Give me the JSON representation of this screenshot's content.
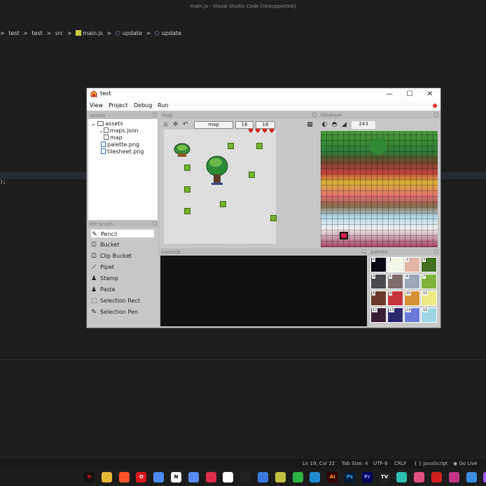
{
  "vscode": {
    "title": "main.js - Visual Studio Code [Unsupported]",
    "breadcrumb": [
      ">",
      "test",
      ">",
      "test",
      ">",
      "src",
      ">",
      "main.js",
      ">",
      "update",
      ">",
      "update"
    ],
    "code_fragment": ");",
    "status": {
      "position": "Ln 19, Col 22",
      "tab_size": "Tab Size: 4",
      "encoding": "UTF-8",
      "eol": "CRLF",
      "language": "{ } JavaScript",
      "golive": "Go Live"
    }
  },
  "taskbar": {
    "apps": [
      {
        "icon": "netflix-icon",
        "label": "N",
        "color": "#111111",
        "fg": "#e50914"
      },
      {
        "icon": "files-icon",
        "label": "",
        "color": "#e8b83a",
        "fg": "#fff"
      },
      {
        "icon": "brave-icon",
        "label": "",
        "color": "#fb542b",
        "fg": "#fff"
      },
      {
        "icon": "opera-icon",
        "label": "O",
        "color": "#e0131d",
        "fg": "#fff"
      },
      {
        "icon": "chrome-icon",
        "label": "",
        "color": "#4c8bf5",
        "fg": "#fff"
      },
      {
        "icon": "notion-icon",
        "label": "N",
        "color": "#ffffff",
        "fg": "#000"
      },
      {
        "icon": "photos-icon",
        "label": "",
        "color": "#5a8af0",
        "fg": "#fff"
      },
      {
        "icon": "disc-icon",
        "label": "",
        "color": "#e02f4d",
        "fg": "#fff"
      },
      {
        "icon": "github-icon",
        "label": "",
        "color": "#ffffff",
        "fg": "#000"
      },
      {
        "icon": "unity-icon",
        "label": "",
        "color": "#222222",
        "fg": "#fff"
      },
      {
        "icon": "globe-icon",
        "label": "",
        "color": "#3a7ae0",
        "fg": "#fff"
      },
      {
        "icon": "inkscape-icon",
        "label": "",
        "color": "#c0c040",
        "fg": "#000"
      },
      {
        "icon": "game-icon",
        "label": "",
        "color": "#2fb344",
        "fg": "#fff"
      },
      {
        "icon": "vscode-icon",
        "label": "",
        "color": "#1f8ad2",
        "fg": "#fff"
      },
      {
        "icon": "illustrator-icon",
        "label": "Ai",
        "color": "#330000",
        "fg": "#ff9a00"
      },
      {
        "icon": "photoshop-icon",
        "label": "Ps",
        "color": "#001e36",
        "fg": "#31a8ff"
      },
      {
        "icon": "premiere-icon",
        "label": "Pr",
        "color": "#00005b",
        "fg": "#9999ff"
      },
      {
        "icon": "tv-icon",
        "label": "TV",
        "color": "#222222",
        "fg": "#fff"
      },
      {
        "icon": "teal-app-icon",
        "label": "",
        "color": "#2dbfb0",
        "fg": "#fff"
      },
      {
        "icon": "paint-icon",
        "label": "",
        "color": "#e05080",
        "fg": "#fff"
      },
      {
        "icon": "camera-icon",
        "label": "",
        "color": "#d02020",
        "fg": "#fff"
      },
      {
        "icon": "instagram-icon",
        "label": "",
        "color": "#c13584",
        "fg": "#fff"
      },
      {
        "icon": "store-icon",
        "label": "",
        "color": "#3a8ae0",
        "fg": "#fff"
      },
      {
        "icon": "figma-icon",
        "label": "",
        "color": "#a259ff",
        "fg": "#fff"
      }
    ]
  },
  "app": {
    "title": "test",
    "window_controls": {
      "minimize": "—",
      "maximize": "☐",
      "close": "✕"
    },
    "menu": [
      "View",
      "Project",
      "Debug",
      "Run"
    ],
    "assets": {
      "header": "assets",
      "tree": [
        {
          "label": "assets",
          "type": "folder",
          "depth": 0
        },
        {
          "label": "maps.json",
          "type": "file",
          "depth": 1
        },
        {
          "label": "map",
          "type": "file",
          "depth": 2
        },
        {
          "label": "palette.png",
          "type": "file",
          "depth": 1
        },
        {
          "label": "tilesheet.png",
          "type": "file",
          "depth": 1
        }
      ]
    },
    "tile_brush": {
      "header": "tile brush",
      "selected": "Pencil",
      "tools": [
        {
          "label": "Pencil",
          "icon": "pencil-icon",
          "glyph": "✎"
        },
        {
          "label": "Bucket",
          "icon": "bucket-icon",
          "glyph": "⛋"
        },
        {
          "label": "Clip Bucket",
          "icon": "clip-bucket-icon",
          "glyph": "⛋"
        },
        {
          "label": "Pipet",
          "icon": "pipet-icon",
          "glyph": "⟋"
        },
        {
          "label": "Stamp",
          "icon": "stamp-icon",
          "glyph": "♟"
        },
        {
          "label": "Paste",
          "icon": "paste-icon",
          "glyph": "♟"
        },
        {
          "label": "Selection Rect",
          "icon": "selection-rect-icon",
          "glyph": "⬚"
        },
        {
          "label": "Selection Pen",
          "icon": "selection-pen-icon",
          "glyph": "✎"
        }
      ]
    },
    "map": {
      "header": "map",
      "map_name": "map",
      "width": "16",
      "height": "16"
    },
    "tilesheet": {
      "header": "tilesheet",
      "tile_index": "243"
    },
    "console": {
      "header": "console"
    },
    "palette": {
      "header": "palette",
      "colors": [
        {
          "index": "0",
          "hex": "#0a0a14"
        },
        {
          "index": "1",
          "hex": "#f1f6e6"
        },
        {
          "index": "2",
          "hex": "#e2b6a6"
        },
        {
          "index": "3",
          "hex": "#426f1e"
        },
        {
          "index": "4",
          "hex": "#4a4a4e"
        },
        {
          "index": "5",
          "hex": "#7d6c6c"
        },
        {
          "index": "6",
          "hex": "#9aa8b8"
        },
        {
          "index": "7",
          "hex": "#80b13b"
        },
        {
          "index": "8",
          "hex": "#6c3a2c"
        },
        {
          "index": "9",
          "hex": "#c8343c"
        },
        {
          "index": "10",
          "hex": "#d89034"
        },
        {
          "index": "11",
          "hex": "#eaea80"
        },
        {
          "index": "12",
          "hex": "#3a1e36"
        },
        {
          "index": "13",
          "hex": "#2c286e"
        },
        {
          "index": "14",
          "hex": "#6a7ad8"
        },
        {
          "index": "15",
          "hex": "#9ed6e6"
        }
      ]
    }
  }
}
